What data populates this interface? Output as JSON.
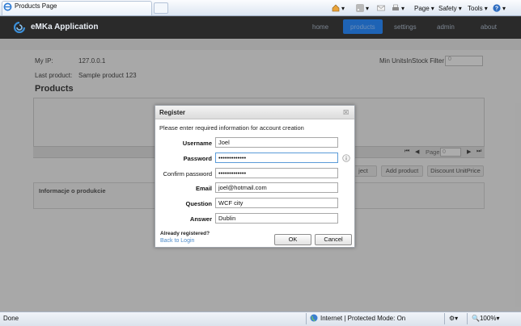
{
  "browser": {
    "tab_title": "Products Page",
    "commands": {
      "page": "Page",
      "safety": "Safety",
      "tools": "Tools"
    }
  },
  "app": {
    "title": "eMKa Application",
    "nav": [
      "home",
      "products",
      "settings",
      "admin",
      "about"
    ]
  },
  "main": {
    "ip_label": "My IP:",
    "ip_value": "127.0.0.1",
    "last_product_label": "Last product:",
    "last_product_value": "Sample product 123",
    "filter_label": "Min UnitsInStock Filter",
    "filter_value": "0",
    "products_title": "Products",
    "pager": {
      "page_label": "Page",
      "page_value": "0"
    },
    "buttons": {
      "delete_partial": "ject",
      "add_product": "Add product",
      "discount": "Discount UnitPrice"
    },
    "details_title": "Informacje o produkcie"
  },
  "modal": {
    "title": "Register",
    "close_glyph": "☒",
    "intro": "Please enter required information for account creation",
    "fields": {
      "username": {
        "label": "Username",
        "value": "Joel"
      },
      "password": {
        "label": "Password",
        "value": "•••••••••••••"
      },
      "confirm": {
        "label": "Confirm password",
        "value": "•••••••••••••"
      },
      "email": {
        "label": "Email",
        "value": "joel@hotmail.com"
      },
      "question": {
        "label": "Question",
        "value": "WCF city"
      },
      "answer": {
        "label": "Answer",
        "value": "Dublin"
      }
    },
    "already_registered": "Already registered?",
    "back_to_login": "Back to Login",
    "ok": "OK",
    "cancel": "Cancel"
  },
  "status": {
    "left": "Done",
    "zone": "Internet | Protected Mode: On",
    "zoom": "100%"
  },
  "colors": {
    "accent": "#1e63b5",
    "header_bg": "#2a2a2a",
    "link": "#4c8ac8"
  }
}
